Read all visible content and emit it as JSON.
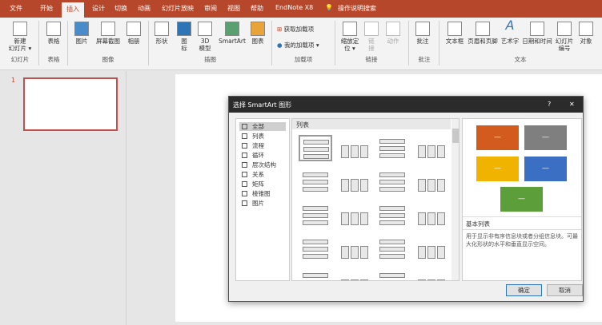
{
  "tabs": [
    "文件",
    "开始",
    "插入",
    "设计",
    "切换",
    "动画",
    "幻灯片放映",
    "审阅",
    "视图",
    "帮助",
    "EndNote X8"
  ],
  "search_label": "操作说明搜索",
  "ribbon": {
    "new_slide": "新建\n幻灯片 ▾",
    "table": "表格",
    "picture": "图片",
    "screenshot": "屏幕截图",
    "album": "相册",
    "shapes": "形状",
    "icons": "图\n标",
    "model3d": "3D\n模型",
    "smartart": "SmartArt",
    "chart": "图表",
    "get_addins": "获取加载项",
    "my_addins": "我的加载项",
    "zoom": "缩放定\n位 ▾",
    "link": "链\n接",
    "action": "动作",
    "comment": "批注",
    "textbox": "文本框",
    "header_footer": "页眉和页脚",
    "wordart": "艺术字",
    "datetime": "日期和时间",
    "slide_number": "幻灯片\n编号",
    "object": "对象",
    "groups": [
      "幻灯片",
      "表格",
      "图像",
      "插图",
      "加载项",
      "链接",
      "批注",
      "文本"
    ]
  },
  "slide_number": "1",
  "dialog": {
    "title": "选择 SmartArt 图形",
    "help": "?",
    "close": "✕",
    "categories": [
      "全部",
      "列表",
      "流程",
      "循环",
      "层次结构",
      "关系",
      "矩阵",
      "棱锥图",
      "图片"
    ],
    "section_header": "列表",
    "preview_title": "基本列表",
    "preview_desc": "用于显示非有序信息块或者分组信息块。可最大化形状的水平和垂直显示空间。",
    "box_text": "—",
    "ok": "确定",
    "cancel": "取消"
  },
  "colors": {
    "accent": "#b7472a",
    "orange": "#d35b1d",
    "gray": "#7f7f7f",
    "yellow": "#f0b400",
    "blue": "#3a6fc4",
    "green": "#5c9e3a"
  }
}
